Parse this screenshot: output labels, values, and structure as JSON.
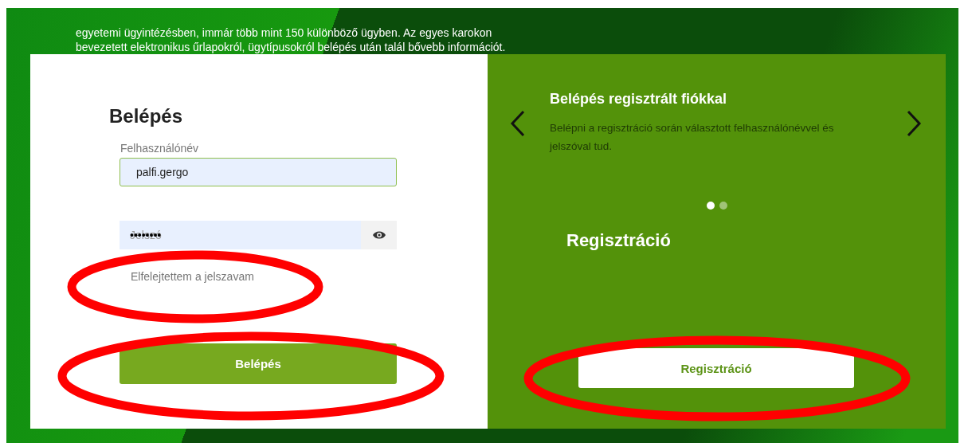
{
  "intro": [
    "egyetemi ügyintézésben, immár több mint 150 különböző ügyben. Az egyes karokon",
    "bevezetett elektronikus űrlapokról, ügytípusokról belépés után talál bővebb információt."
  ],
  "login": {
    "title": "Belépés",
    "username": {
      "label": "Felhasználónév",
      "value": "palfi.gergo"
    },
    "password": {
      "label": "Jelszó",
      "value": "••••••••"
    },
    "forgot": "Elfelejtettem a jelszavam",
    "button": "Belépés"
  },
  "carousel": {
    "title": "Belépés regisztrált fiókkal",
    "text": "Belépni a regisztráció során választott felhasználónévvel és jelszóval tud.",
    "dots": [
      {
        "selected": true
      },
      {
        "selected": false
      }
    ]
  },
  "register": {
    "title": "Regisztráció",
    "button": "Regisztráció"
  }
}
